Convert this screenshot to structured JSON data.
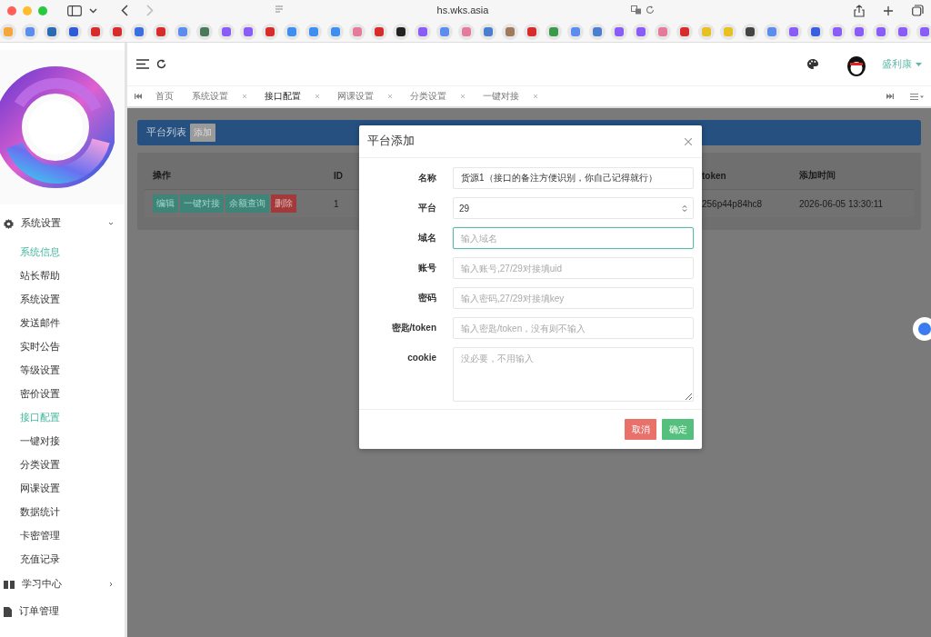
{
  "browser": {
    "address": "hs.wks.asia"
  },
  "header": {
    "user": "盛利康"
  },
  "tabs": [
    {
      "label": "首页",
      "selected": false,
      "closable": false
    },
    {
      "label": "系统设置",
      "selected": false,
      "closable": true
    },
    {
      "label": "接口配置",
      "selected": true,
      "closable": true
    },
    {
      "label": "网课设置",
      "selected": false,
      "closable": true
    },
    {
      "label": "分类设置",
      "selected": false,
      "closable": true
    },
    {
      "label": "一键对接",
      "selected": false,
      "closable": true
    }
  ],
  "sidebar": {
    "items": [
      {
        "label": "系统设置",
        "kind": "group",
        "expanded": true,
        "children": [
          {
            "label": "系统信息",
            "selected": true
          },
          {
            "label": "站长帮助",
            "selected": false
          },
          {
            "label": "系统设置",
            "selected": false
          },
          {
            "label": "发送邮件",
            "selected": false
          },
          {
            "label": "实时公告",
            "selected": false
          },
          {
            "label": "等级设置",
            "selected": false
          },
          {
            "label": "密价设置",
            "selected": false
          },
          {
            "label": "接口配置",
            "selected": true
          },
          {
            "label": "一键对接",
            "selected": false
          },
          {
            "label": "分类设置",
            "selected": false
          },
          {
            "label": "网课设置",
            "selected": false
          },
          {
            "label": "数据统计",
            "selected": false
          },
          {
            "label": "卡密管理",
            "selected": false
          },
          {
            "label": "充值记录",
            "selected": false
          }
        ]
      },
      {
        "label": "学习中心",
        "kind": "group",
        "expanded": false
      },
      {
        "label": "订单管理",
        "kind": "link"
      }
    ]
  },
  "panel": {
    "title": "平台列表",
    "add_button": "添加"
  },
  "table": {
    "columns": [
      "操作",
      "ID",
      "token",
      "添加时间"
    ],
    "rows": [
      {
        "actions": [
          {
            "label": "编辑",
            "kind": "normal"
          },
          {
            "label": "一键对接",
            "kind": "normal"
          },
          {
            "label": "余额查询",
            "kind": "normal"
          },
          {
            "label": "删除",
            "kind": "danger"
          }
        ],
        "id": "1",
        "token": "256p44p84hc8",
        "time": "2026-06-05 13:30:11"
      }
    ]
  },
  "modal": {
    "title": "平台添加",
    "fields": [
      {
        "label": "名称",
        "kind": "text",
        "value": "货源1（接口的备注方便识别，你自己记得就行）",
        "focused": false
      },
      {
        "label": "平台",
        "kind": "select",
        "value": "29",
        "focused": false
      },
      {
        "label": "域名",
        "kind": "text",
        "placeholder": "输入域名",
        "focused": true
      },
      {
        "label": "账号",
        "kind": "text",
        "placeholder": "输入账号,27/29对接填uid",
        "focused": false
      },
      {
        "label": "密码",
        "kind": "text",
        "placeholder": "输入密码,27/29对接填key",
        "focused": false
      },
      {
        "label": "密匙/token",
        "kind": "text",
        "placeholder": "输入密匙/token，没有则不输入",
        "focused": false
      },
      {
        "label": "cookie",
        "kind": "textarea",
        "placeholder": "没必要，不用输入",
        "focused": false
      }
    ],
    "buttons": [
      {
        "label": "取消",
        "kind": "cancel"
      },
      {
        "label": "确定",
        "kind": "confirm"
      }
    ]
  }
}
